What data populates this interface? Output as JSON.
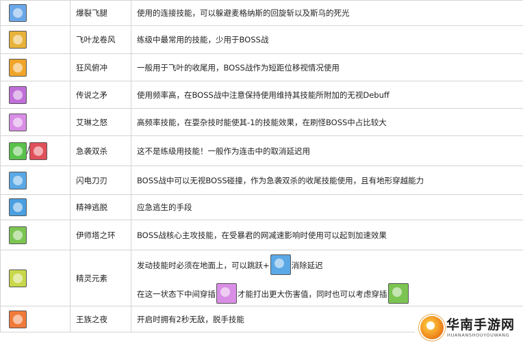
{
  "skills": [
    {
      "icons": [
        {
          "name": "explosion-flying-leg-icon",
          "color": "#6aa7e8"
        }
      ],
      "name": "爆裂飞腿",
      "desc": "使用的连接技能，可以躲避麦格纳斯的回旋斩以及斯乌的死光"
    },
    {
      "icons": [
        {
          "name": "leaf-tornado-icon",
          "color": "#e8b23a"
        }
      ],
      "name": "飞叶龙卷风",
      "desc": "练级中最常用的技能，少用于BOSS战"
    },
    {
      "icons": [
        {
          "name": "gale-dive-icon",
          "color": "#f0a52a"
        }
      ],
      "name": "狂风俯冲",
      "desc": "一般用于飞叶的收尾用，BOSS战作为短距位移视情况使用"
    },
    {
      "icons": [
        {
          "name": "legendary-spear-icon",
          "color": "#c06fd8"
        }
      ],
      "name": "传说之矛",
      "desc": "使用频率高，在BOSS战中注意保持使用维持其技能所附加的无视Debuff"
    },
    {
      "icons": [
        {
          "name": "irina-wrath-icon",
          "color": "#d98ee6"
        }
      ],
      "name": "艾琳之怒",
      "desc": "高频率技能，在耍杂技时能使其-1的技能效果，在刷怪BOSS中占比较大"
    },
    {
      "icons": [
        {
          "name": "twin-assault-green-icon",
          "color": "#58c24a"
        },
        {
          "name": "twin-assault-red-icon",
          "color": "#e0505a"
        }
      ],
      "name": "急袭双杀",
      "desc": "这不是练级用技能！一般作为连击中的取消延迟用"
    },
    {
      "icons": [
        {
          "name": "flash-blade-icon",
          "color": "#5aa8e6"
        }
      ],
      "name": "闪电刀刃",
      "desc": "BOSS战中可以无视BOSS碰撞，作为急袭双杀的收尾技能使用，且有地形穿越能力"
    },
    {
      "icons": [
        {
          "name": "spirit-escape-icon",
          "color": "#4a9fe0"
        }
      ],
      "name": "精神逃脱",
      "desc": "应急逃生的手段"
    },
    {
      "icons": [
        {
          "name": "ifrit-ring-icon",
          "color": "#7cc552"
        }
      ],
      "name": "伊师塔之环",
      "desc": "BOSS战核心主攻技能，在受暴君的网减速影响时使用可以起到加速效果"
    },
    {
      "icons": [
        {
          "name": "elemental-spirit-icon",
          "color": "#c8d84a"
        }
      ],
      "name": "精灵元素",
      "desc_parts": {
        "line1_a": "发动技能时必须在地面上，可以跳跃+",
        "line1_b": "消除延迟",
        "line2_a": "在这一状态下中间穿插",
        "line2_b": "才能打出更大伤害值，同时也可以考虑穿插"
      },
      "inline_icons": [
        {
          "name": "flash-blade-inline-icon",
          "color": "#5aa8e6"
        },
        {
          "name": "irina-wrath-inline-icon",
          "color": "#d98ee6"
        },
        {
          "name": "ifrit-ring-inline-icon",
          "color": "#7cc552"
        }
      ]
    },
    {
      "icons": [
        {
          "name": "royal-night-icon",
          "color": "#f07a3a"
        }
      ],
      "name": "王族之夜",
      "desc": "开启时拥有2秒无敌，脱手技能"
    }
  ],
  "separator": "/",
  "watermark": {
    "title": "华南手游网",
    "subtitle": "HUANANSHOUYOUWANG"
  }
}
